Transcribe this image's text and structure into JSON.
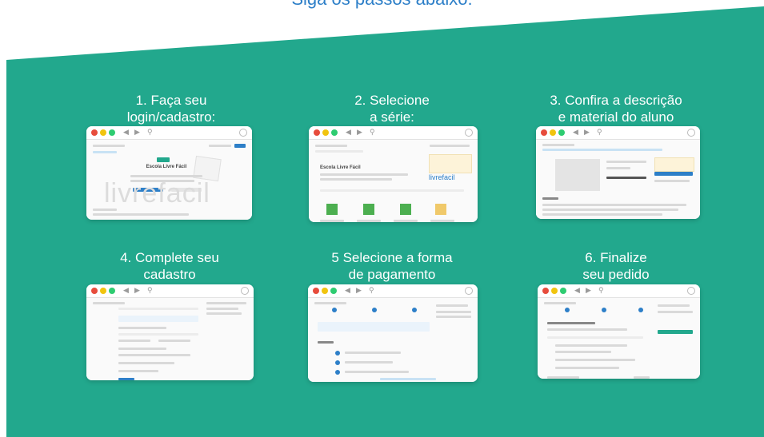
{
  "header": {
    "title": "Siga os passos abaixo:"
  },
  "colors": {
    "green": "#22a88d",
    "title_blue": "#2d7fc8"
  },
  "steps": [
    {
      "title": "1. Faça seu\nlogin/cadastro:"
    },
    {
      "title": "2. Selecione\na série:"
    },
    {
      "title": "3. Confira a descrição\ne material do aluno"
    },
    {
      "title": "4. Complete seu\ncadastro"
    },
    {
      "title": "5 Selecione a forma\nde pagamento"
    },
    {
      "title": "6. Finalize\nseu pedido"
    }
  ],
  "screenshots": {
    "shot1": {
      "school_title": "Escola Livre Fácil",
      "watermark": "livrefacil"
    },
    "shot2": {
      "school_title": "Escola Livre Fácil",
      "brand": "livrefacil"
    }
  }
}
